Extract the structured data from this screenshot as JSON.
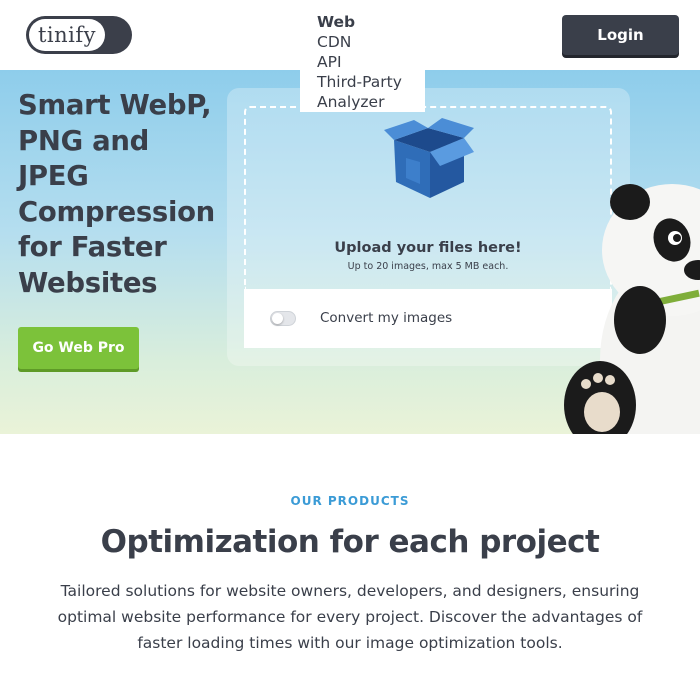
{
  "header": {
    "logo_text": "tinify",
    "nav": [
      "Web",
      "CDN",
      "API",
      "Third-Party",
      "Analyzer"
    ],
    "login_label": "Login"
  },
  "hero": {
    "title": "Smart WebP, PNG and JPEG Compression for Faster Websites",
    "cta_label": "Go Web Pro"
  },
  "upload": {
    "title": "Upload your files here!",
    "subtitle": "Up to 20 images, max 5 MB each.",
    "convert_label": "Convert my images",
    "convert_enabled": false
  },
  "products": {
    "eyebrow": "OUR PRODUCTS",
    "title": "Optimization for each project",
    "description": "Tailored solutions for website owners, developers, and designers, ensuring optimal website performance for every project. Discover the advantages of faster loading times with our image optimization tools."
  },
  "colors": {
    "dark": "#3a3f4a",
    "accent_green": "#7cc23a",
    "accent_blue": "#3b9bd6",
    "box_blue": "#2f6db8",
    "sky": "#8ecdeb"
  },
  "icons": [
    "box-icon",
    "panda-mascot",
    "toggle-icon"
  ]
}
